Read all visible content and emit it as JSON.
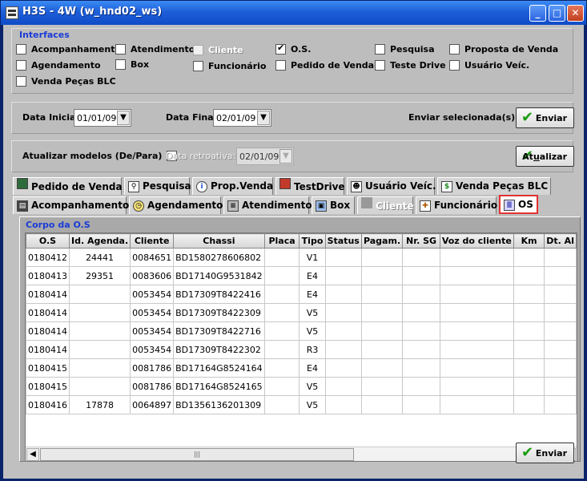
{
  "window": {
    "title": "H3S - 4W (w_hnd02_ws)",
    "minimize": "_",
    "maximize": "□",
    "close": "✕"
  },
  "interfaces": {
    "legend": "Interfaces",
    "items": [
      {
        "label": "Acompanhamento",
        "checked": false,
        "disabled": false
      },
      {
        "label": "Atendimento",
        "checked": false,
        "disabled": false
      },
      {
        "label": "Cliente",
        "checked": false,
        "disabled": true
      },
      {
        "label": "O.S.",
        "checked": true,
        "disabled": false
      },
      {
        "label": "Pesquisa",
        "checked": false,
        "disabled": false
      },
      {
        "label": "Proposta de Venda",
        "checked": false,
        "disabled": false
      },
      {
        "label": "Agendamento",
        "checked": false,
        "disabled": false
      },
      {
        "label": "Box",
        "checked": false,
        "disabled": false
      },
      {
        "label": "Funcionário",
        "checked": false,
        "disabled": false
      },
      {
        "label": "Pedido de Venda",
        "checked": false,
        "disabled": false
      },
      {
        "label": "Teste Drive",
        "checked": false,
        "disabled": false
      },
      {
        "label": "Usuário Veíc.",
        "checked": false,
        "disabled": false
      },
      {
        "label": "Venda Peças BLC",
        "checked": false,
        "disabled": false
      }
    ]
  },
  "dates": {
    "inicial_label": "Data Inicial:",
    "inicial_value": "01/01/09",
    "final_label": "Data Final:",
    "final_value": "02/01/09",
    "enviar_sel_label": "Enviar selecionada(s):",
    "enviar_button": "Enviar"
  },
  "atualizar": {
    "label": "Atualizar modelos (De/Para)",
    "retro_label": "Data retroativa:",
    "retro_value": "02/01/09",
    "button_pre": "At",
    "button_u": "u",
    "button_post": "alizar"
  },
  "tabs_row1": [
    {
      "label": "Pedido de Venda",
      "icon": "grid-icon"
    },
    {
      "label": "Pesquisa",
      "icon": "search-icon"
    },
    {
      "label": "Prop.Venda",
      "icon": "info-icon"
    },
    {
      "label": "TestDrive",
      "icon": "car-icon"
    },
    {
      "label": "Usuário Veíc.",
      "icon": "user-icon"
    },
    {
      "label": "Venda Peças BLC",
      "icon": "money-icon"
    }
  ],
  "tabs_row2": [
    {
      "label": "Acompanhamento",
      "icon": "film-icon"
    },
    {
      "label": "Agendamento",
      "icon": "clock-icon"
    },
    {
      "label": "Atendimento",
      "icon": "database-icon"
    },
    {
      "label": "Box",
      "icon": "window-icon"
    },
    {
      "label": "Cliente",
      "icon": "person-icon",
      "disabled": true
    },
    {
      "label": "Funcionário",
      "icon": "tools-icon"
    },
    {
      "label": "OS",
      "icon": "list-icon",
      "active": true
    }
  ],
  "os_panel": {
    "legend": "Corpo da O.S",
    "columns": [
      "O.S",
      "Id. Agenda.",
      "Cliente",
      "Chassi",
      "Placa",
      "Tipo",
      "Status",
      "Pagam.",
      "Nr. SG",
      "Voz do cliente",
      "Km",
      "Dt. Al"
    ],
    "rows": [
      [
        "0180412",
        "24441",
        "0084651",
        "BD1580278606802",
        "",
        "V1",
        "",
        "",
        "",
        "",
        "",
        ""
      ],
      [
        "0180413",
        "29351",
        "0083606",
        "BD17140G9531842",
        "",
        "E4",
        "",
        "",
        "",
        "",
        "",
        ""
      ],
      [
        "0180414",
        "",
        "0053454",
        "BD17309T8422416",
        "",
        "E4",
        "",
        "",
        "",
        "",
        "",
        ""
      ],
      [
        "0180414",
        "",
        "0053454",
        "BD17309T8422309",
        "",
        "V5",
        "",
        "",
        "",
        "",
        "",
        ""
      ],
      [
        "0180414",
        "",
        "0053454",
        "BD17309T8422716",
        "",
        "V5",
        "",
        "",
        "",
        "",
        "",
        ""
      ],
      [
        "0180414",
        "",
        "0053454",
        "BD17309T8422302",
        "",
        "R3",
        "",
        "",
        "",
        "",
        "",
        ""
      ],
      [
        "0180415",
        "",
        "0081786",
        "BD17164G8524164",
        "",
        "E4",
        "",
        "",
        "",
        "",
        "",
        ""
      ],
      [
        "0180415",
        "",
        "0081786",
        "BD17164G8524165",
        "",
        "V5",
        "",
        "",
        "",
        "",
        "",
        ""
      ],
      [
        "0180416",
        "17878",
        "0064897",
        "BD1356136201309",
        "",
        "V5",
        "",
        "",
        "",
        "",
        "",
        ""
      ]
    ],
    "enviar_button": "Enviar"
  }
}
